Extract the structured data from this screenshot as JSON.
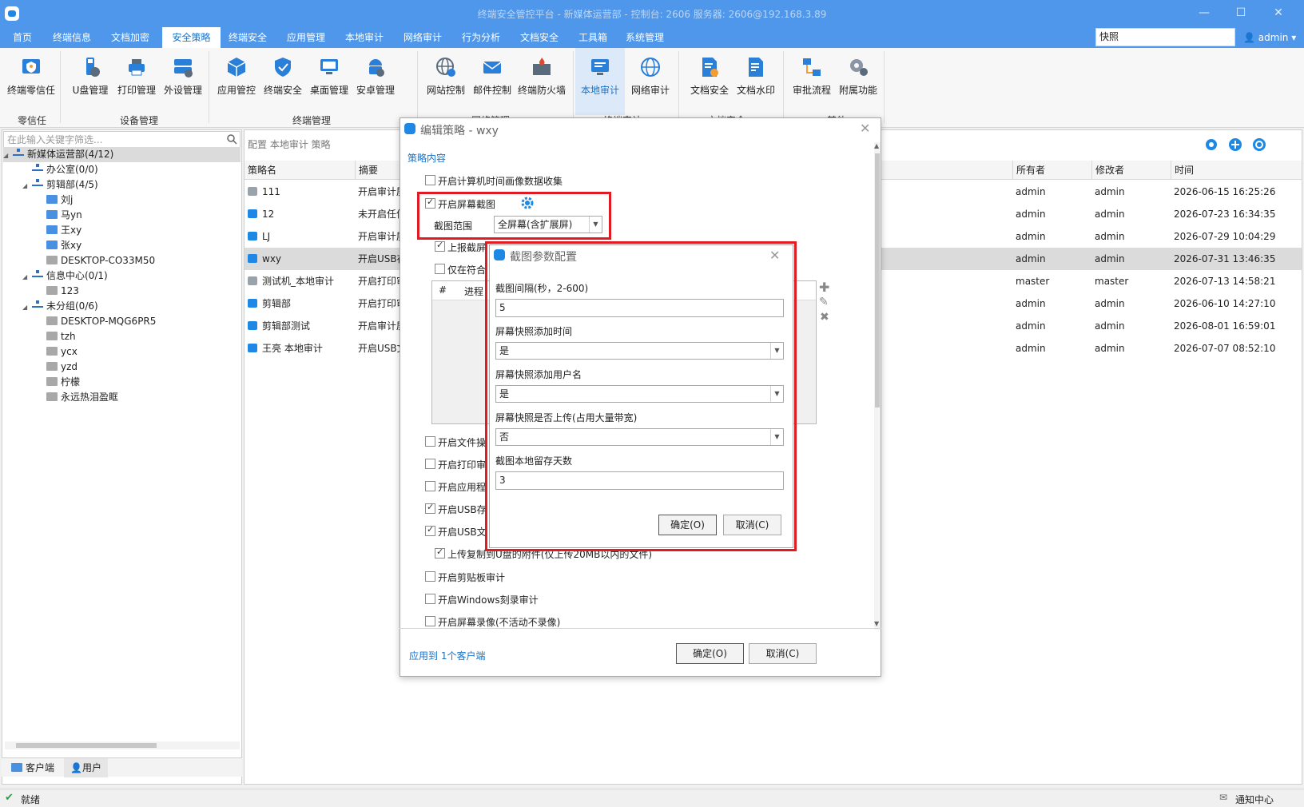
{
  "window": {
    "title": "终端安全管控平台 - 新媒体运营部 - 控制台: 2606 服务器: 2606@192.168.3.89"
  },
  "menu": {
    "items": [
      "首页",
      "终端信息",
      "文档加密",
      "安全策略",
      "终端安全",
      "应用管理",
      "本地审计",
      "网络审计",
      "行为分析",
      "文档安全",
      "工具箱",
      "系统管理"
    ],
    "active_index": 3,
    "search_value": "快照",
    "user": "admin"
  },
  "ribbon": {
    "buttons": [
      "终端零信任",
      "U盘管理",
      "打印管理",
      "外设管理",
      "应用管控",
      "终端安全",
      "桌面管理",
      "安卓管理",
      "网站控制",
      "邮件控制",
      "终端防火墙",
      "本地审计",
      "网络审计",
      "文档安全",
      "文档水印",
      "审批流程",
      "附属功能"
    ],
    "groups": [
      "零信任",
      "设备管理",
      "终端管理",
      "网络管理",
      "终端审计",
      "文档安全",
      "其他"
    ]
  },
  "tree": {
    "filter_placeholder": "在此输入关键字筛选...",
    "nodes": [
      "新媒体运营部(4/12)",
      "办公室(0/0)",
      "剪辑部(4/5)",
      "刘j",
      "马yn",
      "王xy",
      "张xy",
      "DESKTOP-CO33M50",
      "信息中心(0/1)",
      "123",
      "未分组(0/6)",
      "DESKTOP-MQG6PR5",
      "tzh",
      "ycx",
      "yzd",
      "柠檬",
      "永远热泪盈眶"
    ],
    "tabs": [
      "客户端",
      "用户"
    ]
  },
  "main": {
    "breadcrumb": "配置 本地审计 策略",
    "columns": [
      "策略名",
      "摘要",
      "所有者",
      "修改者",
      "时间"
    ],
    "rows": [
      {
        "name": "111",
        "summary": "开启审计屏",
        "owner": "admin",
        "modifier": "admin",
        "time": "2026-06-15 16:25:26"
      },
      {
        "name": "12",
        "summary": "未开启任何",
        "owner": "admin",
        "modifier": "admin",
        "time": "2026-07-23 16:34:35"
      },
      {
        "name": "LJ",
        "summary": "开启审计屏",
        "owner": "admin",
        "modifier": "admin",
        "time": "2026-07-29 10:04:29"
      },
      {
        "name": "wxy",
        "summary": "开启USB存",
        "owner": "admin",
        "modifier": "admin",
        "time": "2026-07-31 13:46:35"
      },
      {
        "name": "测试机_本地审计",
        "summary": "开启打印审",
        "owner": "master",
        "modifier": "master",
        "time": "2026-07-13 14:58:21"
      },
      {
        "name": "剪辑部",
        "summary": "开启打印审",
        "owner": "admin",
        "modifier": "admin",
        "time": "2026-06-10 14:27:10"
      },
      {
        "name": "剪辑部测试",
        "summary": "开启审计屏",
        "owner": "admin",
        "modifier": "admin",
        "time": "2026-08-01 16:59:01"
      },
      {
        "name": "王亮 本地审计",
        "summary": "开启USB文",
        "owner": "admin",
        "modifier": "admin",
        "time": "2026-07-07 08:52:10"
      }
    ]
  },
  "edit_dialog": {
    "title": "编辑策略 - wxy",
    "section": "策略内容",
    "opt_image_collect": "开启计算机时间画像数据收集",
    "opt_screenshot": "开启屏幕截图",
    "scope_label": "截图范围",
    "scope_value": "全屏幕(含扩展屏)",
    "opt_report": "上报截屏",
    "opt_only_match": "仅在符合",
    "table_cols": [
      "#",
      "进程"
    ],
    "opt_file": "开启文件操",
    "opt_print": "开启打印审",
    "opt_app": "开启应用程",
    "opt_usb_store": "开启USB存",
    "opt_usb_file": "开启USB文",
    "opt_upload_copy": "上传复制到U盘的附件(仅上传20MB以内的文件)",
    "opt_clipboard": "开启剪贴板审计",
    "opt_burn": "开启Windows刻录审计",
    "opt_record": "开启屏幕录像(不活动不录像)",
    "apply_link": "应用到 1个客户端",
    "ok": "确定(O)",
    "cancel": "取消(C)"
  },
  "sub_dialog": {
    "title": "截图参数配置",
    "interval_label": "截图间隔(秒，2-600)",
    "interval_value": "5",
    "add_time_label": "屏幕快照添加时间",
    "add_time_value": "是",
    "add_user_label": "屏幕快照添加用户名",
    "add_user_value": "是",
    "upload_label": "屏幕快照是否上传(占用大量带宽)",
    "upload_value": "否",
    "keep_days_label": "截图本地留存天数",
    "keep_days_value": "3",
    "ok": "确定(O)",
    "cancel": "取消(C)"
  },
  "status": {
    "left": "就绪",
    "right": "通知中心"
  },
  "colors": {
    "accent": "#4f97ea",
    "highlight": "#e01b24",
    "link": "#1a73c8"
  }
}
